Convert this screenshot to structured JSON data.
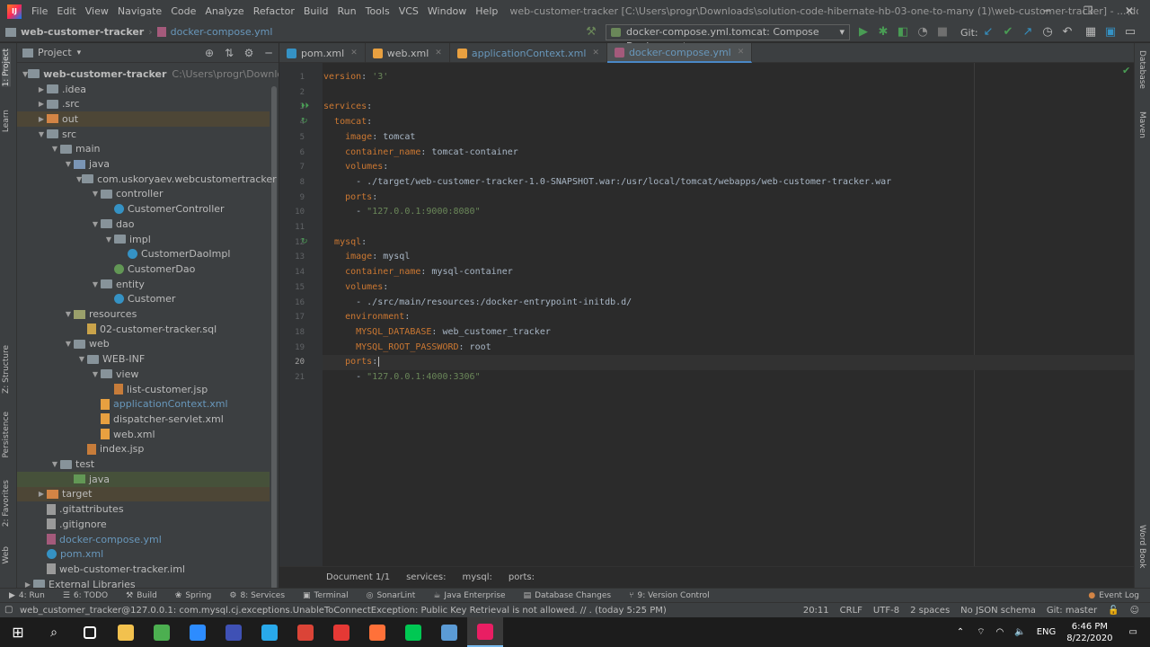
{
  "menu": {
    "items": [
      "File",
      "Edit",
      "View",
      "Navigate",
      "Code",
      "Analyze",
      "Refactor",
      "Build",
      "Run",
      "Tools",
      "VCS",
      "Window",
      "Help"
    ],
    "window_title": "web-customer-tracker [C:\\Users\\progr\\Downloads\\solution-code-hibernate-hb-03-one-to-many (1)\\web-customer-tracker] - ...\\docker-compose.yml"
  },
  "navbar": {
    "project": "web-customer-tracker",
    "file": "docker-compose.yml",
    "run_config": "docker-compose.yml.tomcat: Compose Deployment",
    "git_label": "Git:"
  },
  "left_strip": [
    "1: Project",
    "Learn",
    "Z: Structure",
    "Persistence",
    "2: Favorites",
    "Web"
  ],
  "right_strip": [
    "Database",
    "Maven",
    "Word Book"
  ],
  "project_panel": {
    "title": "Project",
    "root_path": "C:\\Users\\progr\\Downloads\\soluti",
    "tree": [
      {
        "label": "web-customer-tracker",
        "depth": 0,
        "arrow": "open",
        "icon": "folder",
        "bold": true
      },
      {
        "label": ".idea",
        "depth": 1,
        "arrow": "closed",
        "icon": "folder"
      },
      {
        "label": ".src",
        "depth": 1,
        "arrow": "closed",
        "icon": "folder"
      },
      {
        "label": "out",
        "depth": 1,
        "arrow": "closed",
        "icon": "folder-ex",
        "hl": "ex"
      },
      {
        "label": "src",
        "depth": 1,
        "arrow": "open",
        "icon": "folder"
      },
      {
        "label": "main",
        "depth": 2,
        "arrow": "open",
        "icon": "folder"
      },
      {
        "label": "java",
        "depth": 3,
        "arrow": "open",
        "icon": "folder-src"
      },
      {
        "label": "com.uskoryaev.webcustomertracker",
        "depth": 4,
        "arrow": "open",
        "icon": "folder"
      },
      {
        "label": "controller",
        "depth": 5,
        "arrow": "open",
        "icon": "folder"
      },
      {
        "label": "CustomerController",
        "depth": 6,
        "arrow": "",
        "icon": "cls"
      },
      {
        "label": "dao",
        "depth": 5,
        "arrow": "open",
        "icon": "folder"
      },
      {
        "label": "impl",
        "depth": 6,
        "arrow": "open",
        "icon": "folder"
      },
      {
        "label": "CustomerDaoImpl",
        "depth": 7,
        "arrow": "",
        "icon": "cls"
      },
      {
        "label": "CustomerDao",
        "depth": 6,
        "arrow": "",
        "icon": "intf"
      },
      {
        "label": "entity",
        "depth": 5,
        "arrow": "open",
        "icon": "folder"
      },
      {
        "label": "Customer",
        "depth": 6,
        "arrow": "",
        "icon": "cls"
      },
      {
        "label": "resources",
        "depth": 3,
        "arrow": "open",
        "icon": "folder-res"
      },
      {
        "label": "02-customer-tracker.sql",
        "depth": 4,
        "arrow": "",
        "icon": "sqli"
      },
      {
        "label": "web",
        "depth": 3,
        "arrow": "open",
        "icon": "folder"
      },
      {
        "label": "WEB-INF",
        "depth": 4,
        "arrow": "open",
        "icon": "folder"
      },
      {
        "label": "view",
        "depth": 5,
        "arrow": "open",
        "icon": "folder"
      },
      {
        "label": "list-customer.jsp",
        "depth": 6,
        "arrow": "",
        "icon": "jspi"
      },
      {
        "label": "applicationContext.xml",
        "depth": 5,
        "arrow": "",
        "icon": "xmli",
        "blue": true
      },
      {
        "label": "dispatcher-servlet.xml",
        "depth": 5,
        "arrow": "",
        "icon": "xmli"
      },
      {
        "label": "web.xml",
        "depth": 5,
        "arrow": "",
        "icon": "xmli"
      },
      {
        "label": "index.jsp",
        "depth": 4,
        "arrow": "",
        "icon": "jspi"
      },
      {
        "label": "test",
        "depth": 2,
        "arrow": "open",
        "icon": "folder"
      },
      {
        "label": "java",
        "depth": 3,
        "arrow": "",
        "icon": "folder-test",
        "hl": "test"
      },
      {
        "label": "target",
        "depth": 1,
        "arrow": "closed",
        "icon": "folder-ex",
        "hl": "ex"
      },
      {
        "label": ".gitattributes",
        "depth": 1,
        "arrow": "",
        "icon": "filei"
      },
      {
        "label": ".gitignore",
        "depth": 1,
        "arrow": "",
        "icon": "filei"
      },
      {
        "label": "docker-compose.yml",
        "depth": 1,
        "arrow": "",
        "icon": "ymli",
        "blue": true
      },
      {
        "label": "pom.xml",
        "depth": 1,
        "arrow": "",
        "icon": "cls",
        "blue": true
      },
      {
        "label": "web-customer-tracker.iml",
        "depth": 1,
        "arrow": "",
        "icon": "filei"
      },
      {
        "label": "External Libraries",
        "depth": 0,
        "arrow": "closed",
        "icon": "folder"
      }
    ]
  },
  "tabs": [
    {
      "label": "pom.xml",
      "icon_color": "#3592c4",
      "active": false
    },
    {
      "label": "web.xml",
      "icon_color": "#e8a040",
      "active": false
    },
    {
      "label": "applicationContext.xml",
      "icon_color": "#e8a040",
      "active": false,
      "blue": true
    },
    {
      "label": "docker-compose.yml",
      "icon_color": "#a45a7b",
      "active": true,
      "blue": true
    }
  ],
  "code": [
    [
      [
        "k",
        "version"
      ],
      [
        "t",
        ": "
      ],
      [
        "s",
        "'3'"
      ]
    ],
    [],
    [
      [
        "k",
        "services"
      ],
      [
        "t",
        ":"
      ]
    ],
    [
      [
        "t",
        "  "
      ],
      [
        "k",
        "tomcat"
      ],
      [
        "t",
        ":"
      ]
    ],
    [
      [
        "t",
        "    "
      ],
      [
        "k",
        "image"
      ],
      [
        "t",
        ": tomcat"
      ]
    ],
    [
      [
        "t",
        "    "
      ],
      [
        "k",
        "container_name"
      ],
      [
        "t",
        ": tomcat-container"
      ]
    ],
    [
      [
        "t",
        "    "
      ],
      [
        "k",
        "volumes"
      ],
      [
        "t",
        ":"
      ]
    ],
    [
      [
        "t",
        "      - ./target/web-customer-tracker-1.0-SNAPSHOT.war:/usr/local/tomcat/webapps/web-customer-tracker.war"
      ]
    ],
    [
      [
        "t",
        "    "
      ],
      [
        "k",
        "ports"
      ],
      [
        "t",
        ":"
      ]
    ],
    [
      [
        "t",
        "      - "
      ],
      [
        "s",
        "\"127.0.0.1:9000:8080\""
      ]
    ],
    [],
    [
      [
        "t",
        "  "
      ],
      [
        "k",
        "mysql"
      ],
      [
        "t",
        ":"
      ]
    ],
    [
      [
        "t",
        "    "
      ],
      [
        "k",
        "image"
      ],
      [
        "t",
        ": mysql"
      ]
    ],
    [
      [
        "t",
        "    "
      ],
      [
        "k",
        "container_name"
      ],
      [
        "t",
        ": mysql-container"
      ]
    ],
    [
      [
        "t",
        "    "
      ],
      [
        "k",
        "volumes"
      ],
      [
        "t",
        ":"
      ]
    ],
    [
      [
        "t",
        "      - ./src/main/resources:/docker-entrypoint-initdb.d/"
      ]
    ],
    [
      [
        "t",
        "    "
      ],
      [
        "k",
        "environment"
      ],
      [
        "t",
        ":"
      ]
    ],
    [
      [
        "t",
        "      "
      ],
      [
        "k",
        "MYSQL_DATABASE"
      ],
      [
        "t",
        ": web_customer_tracker"
      ]
    ],
    [
      [
        "t",
        "      "
      ],
      [
        "k",
        "MYSQL_ROOT_PASSWORD"
      ],
      [
        "t",
        ": root"
      ]
    ],
    [
      [
        "t",
        "    "
      ],
      [
        "k",
        "ports"
      ],
      [
        "t",
        ":"
      ]
    ],
    [
      [
        "t",
        "      - "
      ],
      [
        "s",
        "\"127.0.0.1:4000:3306\""
      ]
    ]
  ],
  "current_line": 20,
  "editor_breadcrumb": [
    "Document 1/1",
    "services:",
    "mysql:",
    "ports:"
  ],
  "tool_windows": [
    {
      "icon": "▶",
      "label": "4: Run"
    },
    {
      "icon": "☰",
      "label": "6: TODO"
    },
    {
      "icon": "⚒",
      "label": "Build"
    },
    {
      "icon": "❀",
      "label": "Spring"
    },
    {
      "icon": "⚙",
      "label": "8: Services"
    },
    {
      "icon": "▣",
      "label": "Terminal"
    },
    {
      "icon": "◎",
      "label": "SonarLint"
    },
    {
      "icon": "☕",
      "label": "Java Enterprise"
    },
    {
      "icon": "▤",
      "label": "Database Changes"
    },
    {
      "icon": "⑂",
      "label": "9: Version Control"
    }
  ],
  "event_log": "Event Log",
  "status": {
    "message": "web_customer_tracker@127.0.0.1: com.mysql.cj.exceptions.UnableToConnectException: Public Key Retrieval is not allowed. // . (today 5:25 PM)",
    "position": "20:11",
    "line_sep": "CRLF",
    "encoding": "UTF-8",
    "indent": "2 spaces",
    "schema": "No JSON schema",
    "git": "Git: master"
  },
  "taskbar": {
    "lang": "ENG",
    "time": "6:46 PM",
    "date": "8/22/2020",
    "apps": [
      "#2a2a2a",
      "#f2c14e",
      "#4caf50",
      "#2d8cff",
      "#3f51b5",
      "#29a9eb",
      "#db4437",
      "#e53935",
      "#ff7139",
      "#00c853",
      "#5b9bd5",
      "#e91e63"
    ]
  }
}
